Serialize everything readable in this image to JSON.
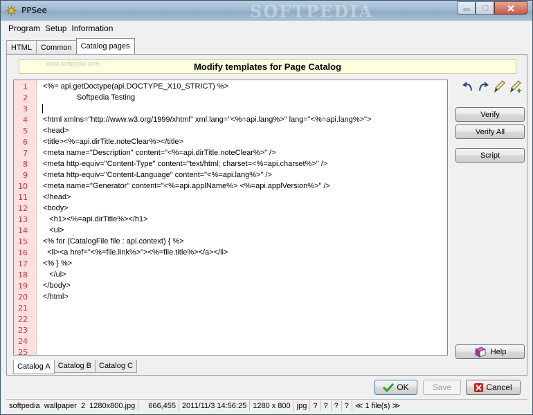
{
  "window": {
    "title": "PPSee",
    "watermark": "SOFTPEDIA"
  },
  "menu": [
    "Program",
    "Setup",
    "Information"
  ],
  "tabs": [
    "HTML",
    "Common",
    "Catalog pages"
  ],
  "active_tab": "Catalog pages",
  "header": {
    "title": "Modify templates for Page Catalog",
    "watermark": "www.softpedia.com"
  },
  "editor": {
    "line_numbers": [
      "1",
      "2",
      "3",
      "4",
      "5",
      "6",
      "7",
      "8",
      "9",
      "10",
      "11",
      "12",
      "13",
      "14",
      "15",
      "16",
      "17",
      "18",
      "19",
      "20",
      "21",
      "22",
      "23",
      "24",
      "25"
    ],
    "lines": [
      "<%= api.getDoctype(api.DOCTYPE_X10_STRICT) %>",
      "                Softpedia Testing",
      "",
      "<html xmlns=\"http://www.w3.org/1999/xhtml\" xml:lang=\"<%=api.lang%>\" lang=\"<%=api.lang%>\">",
      "<head>",
      "<title><%=api.dirTitle.noteClear%></title>",
      "<meta name=\"Description\" content=\"<%=api.dirTitle.noteClear%>\" />",
      "<meta http-equiv=\"Content-Type\" content=\"text/html; charset=<%=api.charset%>\" />",
      "<meta http-equiv=\"Content-Language\" content=\"<%=api.lang%>\" />",
      "<meta name=\"Generator\" content=\"<%=api.applName%> <%=api.applVersion%>\" />",
      "</head>",
      "<body>",
      "   <h1><%=api.dirTitle%></h1>",
      "   <ul>",
      "<% for (CatalogFile file : api.context) { %>",
      "  <li><a href=\"<%=file.link%>\"><%=file.title%></a></li>",
      "<% } %>",
      "   </ul>",
      "</body>",
      "</html>"
    ]
  },
  "toolbar_icons": [
    "undo-icon",
    "redo-icon",
    "brush-icon",
    "brush-plus-icon"
  ],
  "side_buttons": {
    "verify": "Verify",
    "verify_all": "Verify All",
    "script": "Script",
    "help": "Help"
  },
  "catalog_tabs": [
    "Catalog A",
    "Catalog B",
    "Catalog C"
  ],
  "active_catalog": "Catalog A",
  "dialog_buttons": {
    "ok": "OK",
    "save": "Save",
    "cancel": "Cancel"
  },
  "status": [
    "softpedia  wallpaper  2  1280x800.jpg",
    "666,455",
    "2011/11/3 14:56:25",
    "1280 x 800",
    "jpg",
    "?",
    "?",
    "?",
    "?",
    "≪ 1 file(s) ≫"
  ],
  "colors": {
    "banner_bg": "#ffffe0",
    "gutter_bg": "#ffe0e0",
    "line_number": "#cc3333",
    "ok_check": "#2ea02e",
    "cancel_x": "#cc2222"
  }
}
